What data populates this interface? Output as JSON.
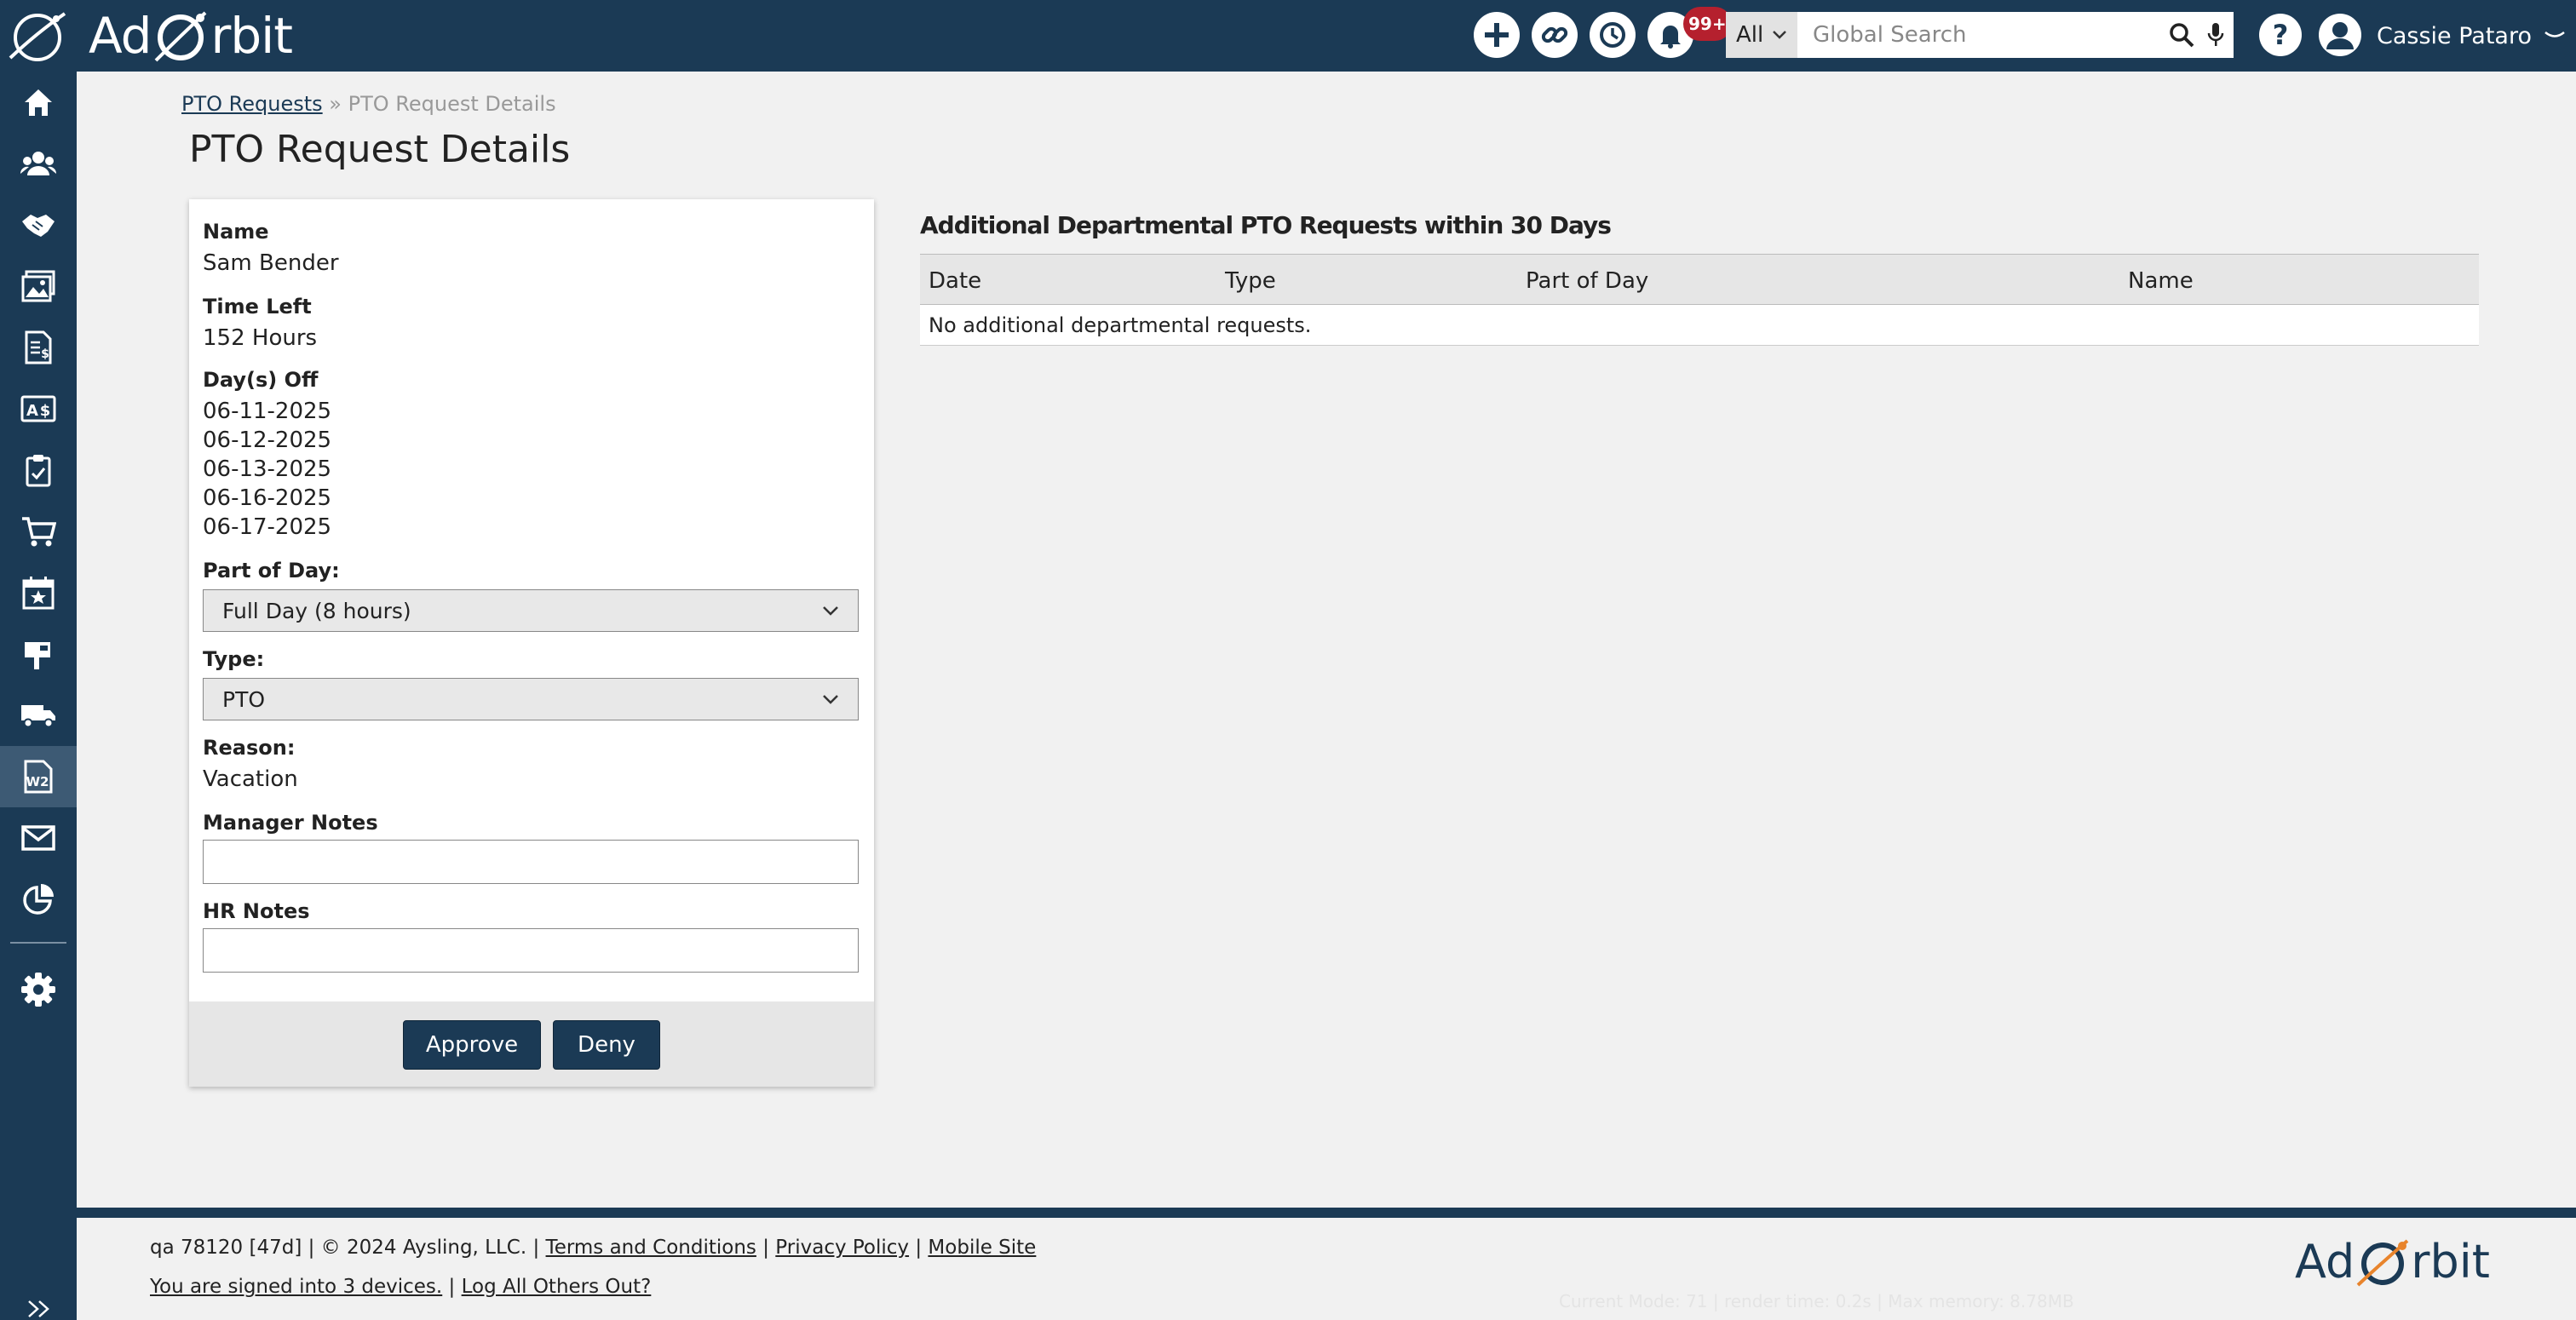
{
  "app": {
    "logo_left": "Ad",
    "logo_right": "rbit"
  },
  "topbar": {
    "notification_count": "99+",
    "search_scope": "All",
    "search_placeholder": "Global Search",
    "user_name": "Cassie Pataro"
  },
  "breadcrumb": {
    "parent": "PTO Requests",
    "separator": "»",
    "current": "PTO Request Details"
  },
  "page_title": "PTO Request Details",
  "request": {
    "name_label": "Name",
    "name_value": "Sam Bender",
    "time_left_label": "Time Left",
    "time_left_value": "152 Hours",
    "days_off_label": "Day(s) Off",
    "days_off": [
      "06-11-2025",
      "06-12-2025",
      "06-13-2025",
      "06-16-2025",
      "06-17-2025"
    ],
    "part_of_day_label": "Part of Day:",
    "part_of_day_value": "Full Day (8 hours)",
    "type_label": "Type:",
    "type_value": "PTO",
    "reason_label": "Reason:",
    "reason_value": "Vacation",
    "manager_notes_label": "Manager Notes",
    "manager_notes_value": "",
    "hr_notes_label": "HR Notes",
    "hr_notes_value": "",
    "approve_label": "Approve",
    "deny_label": "Deny"
  },
  "departmental": {
    "title": "Additional Departmental PTO Requests within 30 Days",
    "columns": [
      "Date",
      "Type",
      "Part of Day",
      "Name"
    ],
    "empty_message": "No additional departmental requests."
  },
  "footer": {
    "build": "qa 78120 [47d] | © 2024 Aysling, LLC. |",
    "terms": "Terms and Conditions",
    "privacy": "Privacy Policy",
    "mobile": "Mobile Site",
    "signed_in": "You are signed into 3 devices.",
    "log_out_others": "Log All Others Out?",
    "sep": "|",
    "perf": "Current Mode: 71 | render time: 0.2s | Max memory: 8.78MB"
  },
  "colors": {
    "brand": "#1b3a55",
    "accent": "#e8842c",
    "badge": "#b5202e"
  },
  "icons": {
    "sidebar": [
      "home-icon",
      "contacts-icon",
      "handshake-icon",
      "media-icon",
      "invoice-icon",
      "money-icon",
      "clipboard-icon",
      "cart-icon",
      "calendar-star-icon",
      "mailbox-icon",
      "truck-icon",
      "w2-icon",
      "envelope-icon",
      "chart-icon",
      "gear-icon"
    ],
    "topbar": [
      "plus-icon",
      "link-icon",
      "history-icon",
      "bell-icon",
      "search-icon",
      "microphone-icon",
      "help-icon",
      "avatar-icon"
    ]
  }
}
